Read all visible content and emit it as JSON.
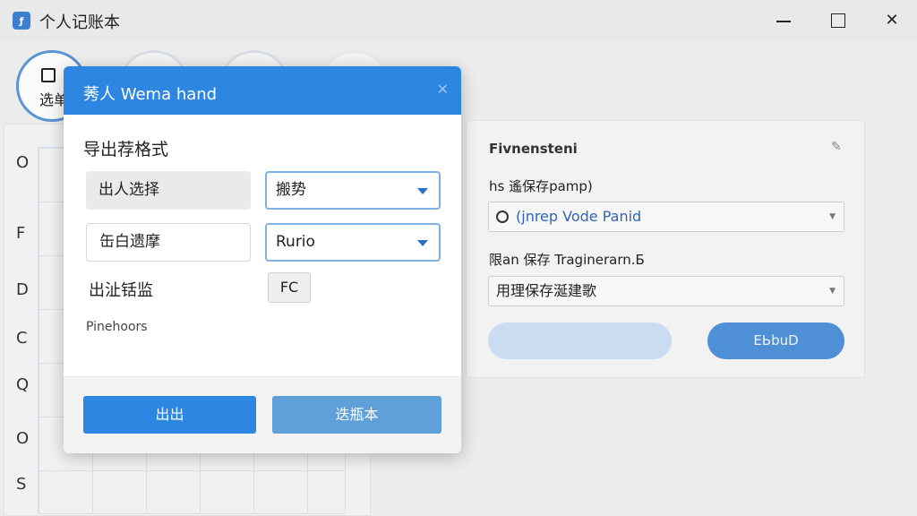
{
  "window": {
    "title": "个人记账本",
    "app_icon": "ƒ",
    "close_glyph": "✕"
  },
  "toolbar": {
    "active_label": "选单"
  },
  "table": {
    "row_letters": [
      "O",
      "F",
      "D",
      "C",
      "Q",
      "O",
      "S"
    ]
  },
  "right_panel": {
    "title": "Fivnensteni",
    "edit_glyph": "✎",
    "label1": "hs 遙保存pamp)",
    "select1": "(jnrep Vode Panid",
    "label2": "限an 保存 Traginerarn.Б",
    "select2": "用理保存涎建歌",
    "blue_button": "ЕЬbuD"
  },
  "dialog": {
    "title": "莠人 Wema hand",
    "close_glyph": "✕",
    "section": "导出荐格式",
    "field1": "出人选择",
    "field2": "缶白遗摩",
    "select1": "搬势",
    "select2": "Rurio",
    "label3": "出沚铦监",
    "fc_button": "FC",
    "small_text": "Pinehoors",
    "primary_button": "出出",
    "secondary_button": "迭瓶本"
  },
  "colors": {
    "accent": "#2d87e2",
    "secondary_button": "#5fa0db",
    "window_bg": "#ececec"
  }
}
